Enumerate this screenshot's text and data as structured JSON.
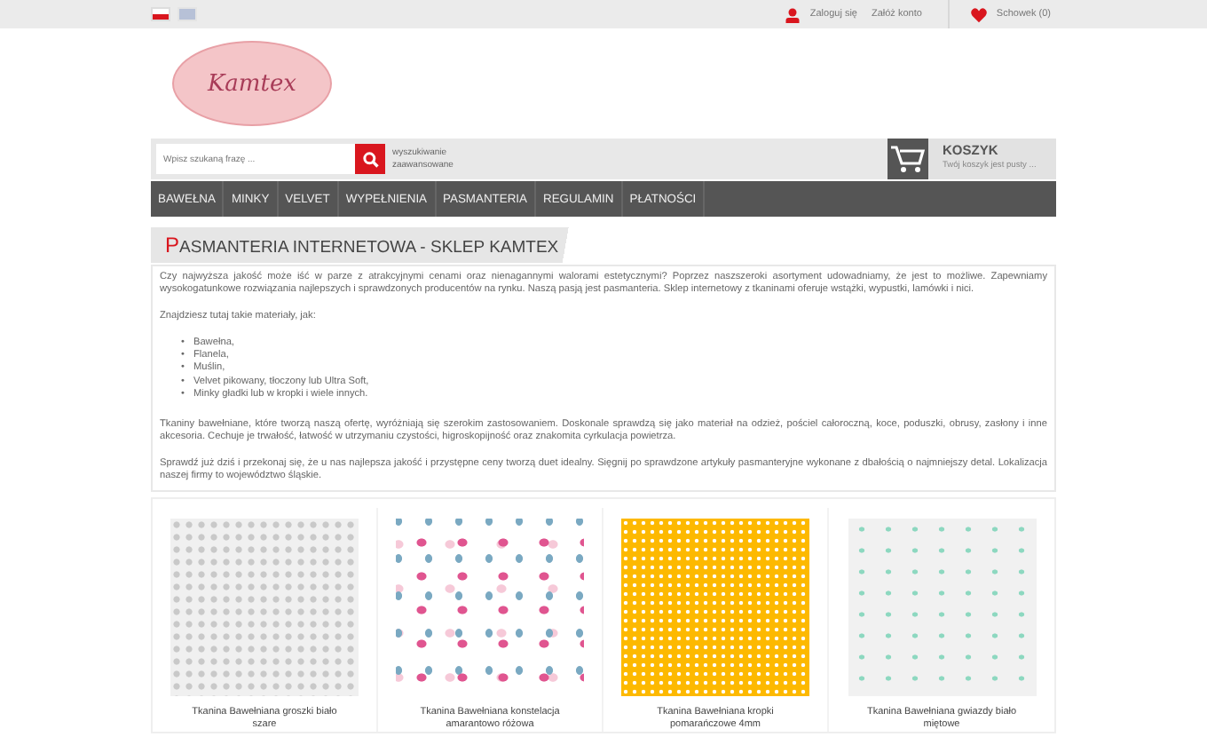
{
  "top_bar": {
    "languages": [
      {
        "kind": "pl",
        "selected": true
      },
      {
        "kind": "en",
        "selected": false
      }
    ],
    "login": "Zaloguj się",
    "register": "Załóż konto",
    "wishlist": "Schowek (0)"
  },
  "logo": {
    "text": "Kamtex"
  },
  "search": {
    "placeholder": "Wpisz szukaną frazę ...",
    "advanced": "wyszukiwanie zaawansowane"
  },
  "cart": {
    "title": "KOSZYK",
    "status": "Twój koszyk jest pusty ..."
  },
  "nav": [
    "BAWEŁNA",
    "MINKY",
    "VELVET",
    "WYPEŁNIENIA",
    "PASMANTERIA",
    "REGULAMIN",
    "PŁATNOŚCI"
  ],
  "heading": "PASMANTERIA INTERNETOWA - SKLEP KAMTEX",
  "content": [
    {
      "kind": "p",
      "text": "Czy najwyższa jakość może iść w parze z atrakcyjnymi cenami oraz nienagannymi walorami estetycznymi? Poprzez naszszeroki asortyment udowadniamy, że jest to możliwe. Zapewniamy wysokogatunkowe rozwiązania najlepszych i sprawdzonych producentów na rynku. Naszą pasją jest pasmanteria. Sklep internetowy z tkaninami oferuje wstążki, wypustki, lamówki i nici."
    },
    {
      "kind": "p",
      "text": "Znajdziesz tutaj takie materiały, jak:"
    },
    {
      "kind": "list",
      "marker": "•",
      "items": [
        "Bawełna,",
        "Flanela,",
        "Muślin,",
        "Velvet pikowany, tłoczony lub Ultra Soft,",
        "Minky gładki lub w kropki i wiele innych."
      ]
    },
    {
      "kind": "p",
      "text": "Tkaniny bawełniane, które tworzą naszą ofertę, wyróżniają się szerokim zastosowaniem. Doskonale sprawdzą się jako materiał na odzież, pościel całoroczną, koce, poduszki, obrusy, zasłony i inne akcesoria. Cechuje je trwałość, łatwość w utrzymaniu czystości, higroskopijność oraz znakomita cyrkulacja powietrza."
    },
    {
      "kind": "p",
      "text": "Sprawdź już dziś i przekonaj się, że u nas najlepsza jakość i przystępne ceny tworzą duet idealny. Sięgnij po sprawdzone artykuły pasmanteryjne wykonane z dbałością o najmniejszy detal. Lokalizacja naszej firmy to województwo śląskie."
    }
  ],
  "products": [
    {
      "kind": "grey-dots",
      "title": "Tkanina Bawełniana groszki biało szare"
    },
    {
      "kind": "stars",
      "title": "Tkanina Bawełniana konstelacja amarantowo różowa"
    },
    {
      "kind": "orange-dots",
      "title": "Tkanina Bawełniana kropki pomarańczowe 4mm"
    },
    {
      "kind": "mint-stars",
      "title": "Tkanina Bawełniana gwiazdy biało miętowe"
    }
  ]
}
